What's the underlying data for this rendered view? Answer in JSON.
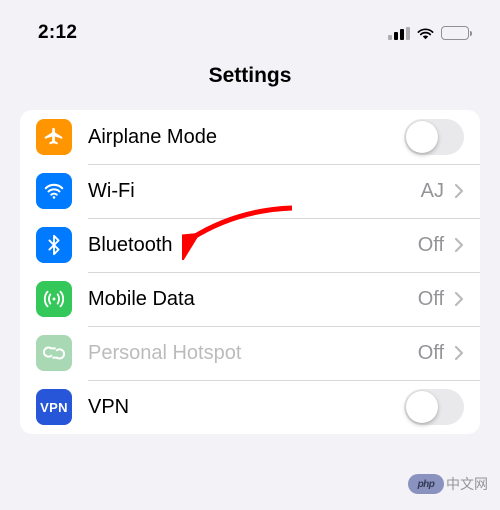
{
  "status": {
    "time": "2:12"
  },
  "header": {
    "title": "Settings"
  },
  "rows": {
    "airplane": {
      "label": "Airplane Mode"
    },
    "wifi": {
      "label": "Wi-Fi",
      "value": "AJ"
    },
    "bluetooth": {
      "label": "Bluetooth",
      "value": "Off"
    },
    "cellular": {
      "label": "Mobile Data",
      "value": "Off"
    },
    "hotspot": {
      "label": "Personal Hotspot",
      "value": "Off"
    },
    "vpn": {
      "label": "VPN",
      "icon_text": "VPN"
    }
  },
  "watermark": {
    "logo": "php",
    "text": "中文网"
  }
}
